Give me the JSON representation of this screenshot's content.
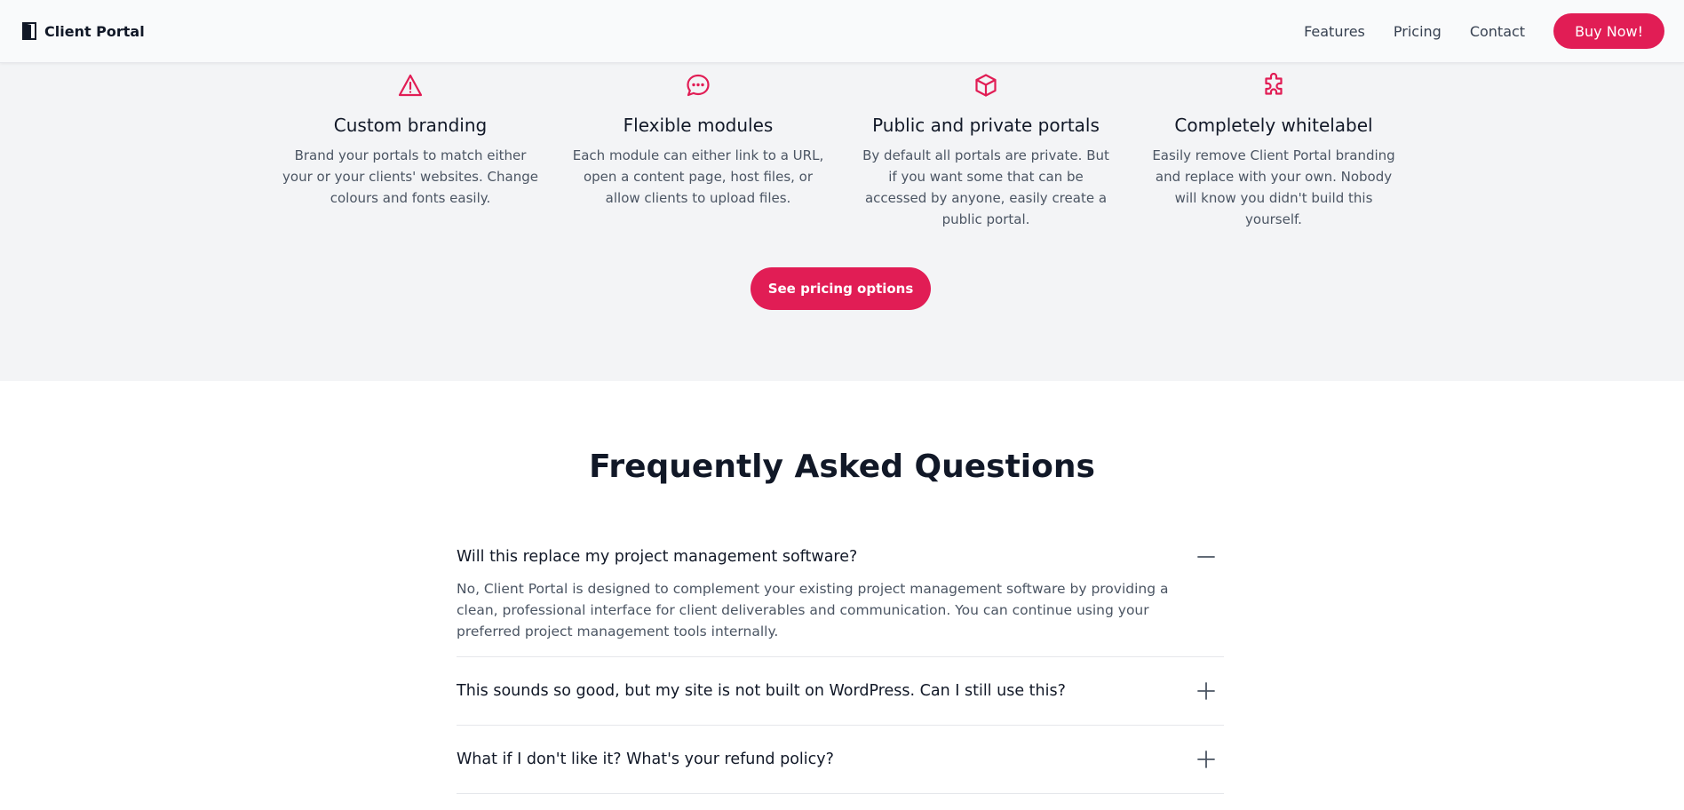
{
  "header": {
    "brand": "Client Portal",
    "nav": [
      "Features",
      "Pricing",
      "Contact"
    ],
    "cta": "Buy Now!"
  },
  "features": [
    {
      "icon": "warning-triangle-icon",
      "title": "Custom branding",
      "desc": "Brand your portals to match either your or your clients' websites. Change colours and fonts easily."
    },
    {
      "icon": "chat-bubble-icon",
      "title": "Flexible modules",
      "desc": "Each module can either link to a URL, open a content page, host files, or allow clients to upload files."
    },
    {
      "icon": "cube-icon",
      "title": "Public and private portals",
      "desc": "By default all portals are private. But if you want some that can be accessed by anyone, easily create a public portal."
    },
    {
      "icon": "puzzle-piece-icon",
      "title": "Completely whitelabel",
      "desc": "Easily remove Client Portal branding and replace with your own. Nobody will know you didn't build this yourself."
    }
  ],
  "pricing_button": "See pricing options",
  "faq": {
    "title": "Frequently Asked Questions",
    "items": [
      {
        "question": "Will this replace my project management software?",
        "answer": "No, Client Portal is designed to complement your existing project management software by providing a clean, professional interface for client deliverables and communication. You can continue using your preferred project management tools internally.",
        "open": true
      },
      {
        "question": "This sounds so good, but my site is not built on WordPress. Can I still use this?",
        "open": false
      },
      {
        "question": "What if I don't like it? What's your refund policy?",
        "open": false
      }
    ]
  },
  "colors": {
    "accent": "#e11d55",
    "section_bg": "#f3f4f6",
    "header_bg": "#f9fafb"
  }
}
